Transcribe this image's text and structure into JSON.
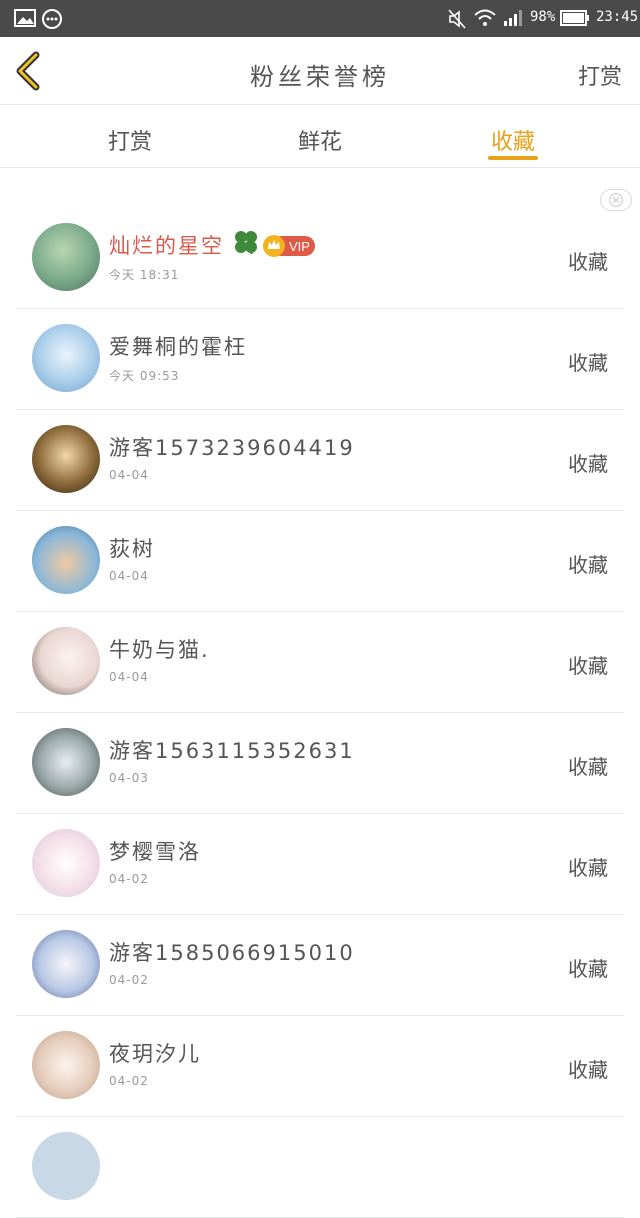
{
  "status_bar": {
    "battery": "98%",
    "time": "23:45"
  },
  "header": {
    "title": "粉丝荣誉榜",
    "right": "打赏"
  },
  "tabs": [
    {
      "label": "打赏"
    },
    {
      "label": "鲜花"
    },
    {
      "label": "收藏"
    }
  ],
  "list": [
    {
      "name": "灿烂的星空",
      "time": "今天 18:31",
      "action": "收藏",
      "vip": "VIP"
    },
    {
      "name": "爱舞桐的霍枉",
      "time": "今天 09:53",
      "action": "收藏"
    },
    {
      "name": "游客1573239604419",
      "time": "04-04",
      "action": "收藏"
    },
    {
      "name": "荻树",
      "time": "04-04",
      "action": "收藏"
    },
    {
      "name": "牛奶与猫.",
      "time": "04-04",
      "action": "收藏"
    },
    {
      "name": "游客1563115352631",
      "time": "04-03",
      "action": "收藏"
    },
    {
      "name": "梦樱雪洛",
      "time": "04-02",
      "action": "收藏"
    },
    {
      "name": "游客1585066915010",
      "time": "04-02",
      "action": "收藏"
    },
    {
      "name": "夜玥汐儿",
      "time": "04-02",
      "action": "收藏"
    }
  ],
  "colors": {
    "accent": "#e8a218",
    "vip": "#e05a49",
    "highlight_name": "#d9594b"
  }
}
